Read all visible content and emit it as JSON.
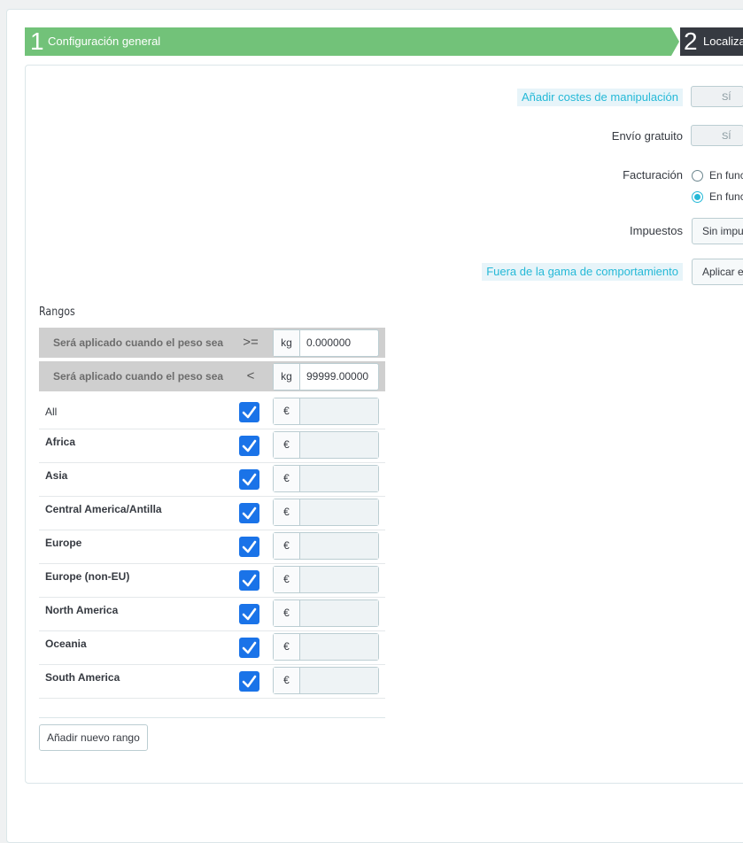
{
  "wizard": {
    "step1": {
      "number": "1",
      "label": "Configuración general"
    },
    "step2": {
      "number": "2",
      "label": "Localiza"
    }
  },
  "form": {
    "handling_costs": {
      "label": "Añadir costes de manipulación",
      "toggle": "SÍ"
    },
    "free_shipping": {
      "label": "Envío gratuito",
      "toggle": "SÍ"
    },
    "billing": {
      "label": "Facturación",
      "options": [
        {
          "label": "En func",
          "selected": false
        },
        {
          "label": "En func",
          "selected": true
        }
      ]
    },
    "taxes": {
      "label": "Impuestos",
      "value": "Sin impu"
    },
    "out_of_range": {
      "label": "Fuera de la gama de comportamiento",
      "value": "Aplicar e"
    }
  },
  "ranges": {
    "title": "Rangos",
    "from": {
      "label": "Será aplicado cuando el peso sea",
      "operator": ">=",
      "unit": "kg",
      "value": "0.000000"
    },
    "to": {
      "label": "Será aplicado cuando el peso sea",
      "operator": "<",
      "unit": "kg",
      "value": "99999.00000"
    },
    "currency": "€",
    "zones": [
      {
        "name": "All",
        "checked": true
      },
      {
        "name": "Africa",
        "checked": true
      },
      {
        "name": "Asia",
        "checked": true
      },
      {
        "name": "Central America/Antilla",
        "checked": true
      },
      {
        "name": "Europe",
        "checked": true
      },
      {
        "name": "Europe (non-EU)",
        "checked": true
      },
      {
        "name": "North America",
        "checked": true
      },
      {
        "name": "Oceania",
        "checked": true
      },
      {
        "name": "South America",
        "checked": true
      }
    ],
    "add_button": "Añadir nuevo rango"
  }
}
